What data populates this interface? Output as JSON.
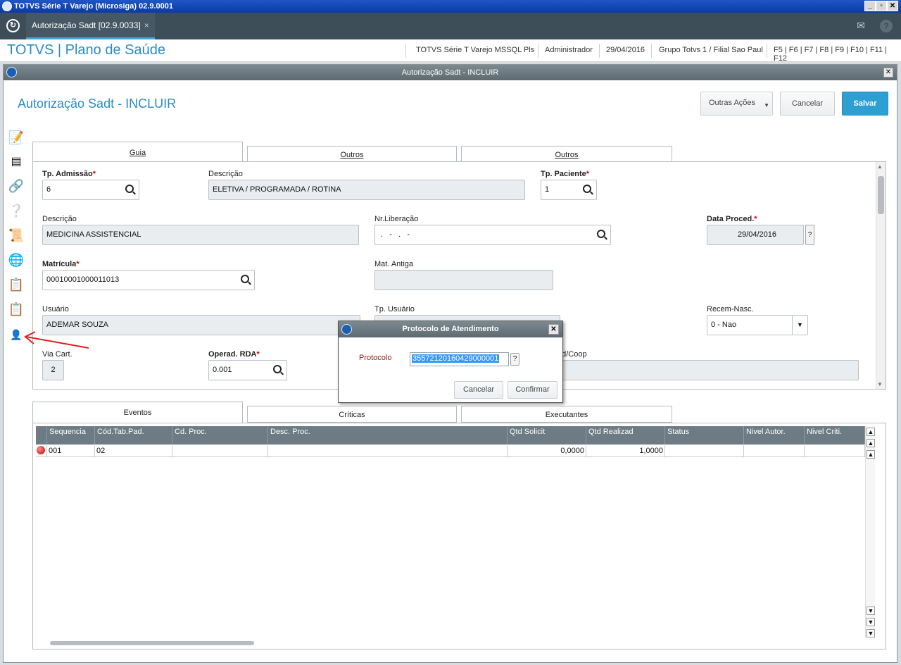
{
  "os": {
    "title": "TOTVS Série T Varejo (Microsiga) 02.9.0001"
  },
  "tabbar": {
    "tab_label": "Autorização Sadt [02.9.0033]",
    "tab_close": "×"
  },
  "header": {
    "brand": "TOTVS | Plano de Saúde",
    "env": "TOTVS Série T Varejo MSSQL Pls",
    "user": "Administrador",
    "date": "29/04/2016",
    "company": "Grupo Totvs 1 / Filial Sao Paul",
    "keys": "F5 | F6 | F7 | F8 | F9 | F10 | F11 | F12"
  },
  "window": {
    "title": "Autorização Sadt - INCLUIR"
  },
  "page": {
    "title": "Autorização Sadt - INCLUIR",
    "other_actions": "Outras Ações",
    "cancel": "Cancelar",
    "save": "Salvar"
  },
  "tabs_top": [
    "Guia",
    "Outros",
    "Outros"
  ],
  "form": {
    "tp_admissao_label": "Tp. Admissão",
    "tp_admissao": "6",
    "descricao1_label": "Descrição",
    "descricao1": "ELETIVA / PROGRAMADA / ROTINA",
    "tp_paciente_label": "Tp. Paciente",
    "tp_paciente": "1",
    "descricao2_label": "Descrição",
    "descricao2": "MEDICINA ASSISTENCIAL",
    "nr_liberacao_label": "Nr.Liberação",
    "nr_liberacao": " .   -   .   -",
    "data_proced_label": "Data Proced.",
    "data_proced": "29/04/2016",
    "matricula_label": "Matrícula",
    "matricula": "00010001000011013",
    "mat_antiga_label": "Mat. Antiga",
    "mat_antiga": "",
    "usuario_label": "Usuário",
    "usuario": "ADEMAR SOUZA",
    "tp_usuario_label": "Tp. Usuário",
    "recem_nasc_label": "Recem-Nasc.",
    "recem_nasc": "0 - Nao",
    "via_cart_label": "Via Cart.",
    "via_cart": "2",
    "operad_rda_label": "Operad. RDA",
    "operad_rda": "0.001",
    "med_coop_label": "ed/Coop"
  },
  "tabs_bottom": [
    "Eventos",
    "Críticas",
    "Executantes"
  ],
  "grid": {
    "columns": [
      "Sequencia",
      "Cód.Tab.Pad.",
      "Cd. Proc.",
      "Desc. Proc.",
      "Qtd Solicit",
      "Qtd Realizad",
      "Status",
      "Nivel Autor.",
      "Nivel Criti."
    ],
    "rows": [
      [
        "001",
        "02",
        "",
        "",
        "0,0000",
        "1,0000",
        "",
        "",
        ""
      ]
    ]
  },
  "dialog": {
    "title": "Protocolo de Atendimento",
    "protocolo_label": "Protocolo",
    "protocolo": "35572120160429000001",
    "cancel": "Cancelar",
    "confirm": "Confirmar",
    "help": "?"
  },
  "colors": {
    "accent": "#2a8cc6",
    "primary_button": "#2d9fd1",
    "tabbar": "#3d4e59",
    "annotation_arrow": "#e02020"
  }
}
